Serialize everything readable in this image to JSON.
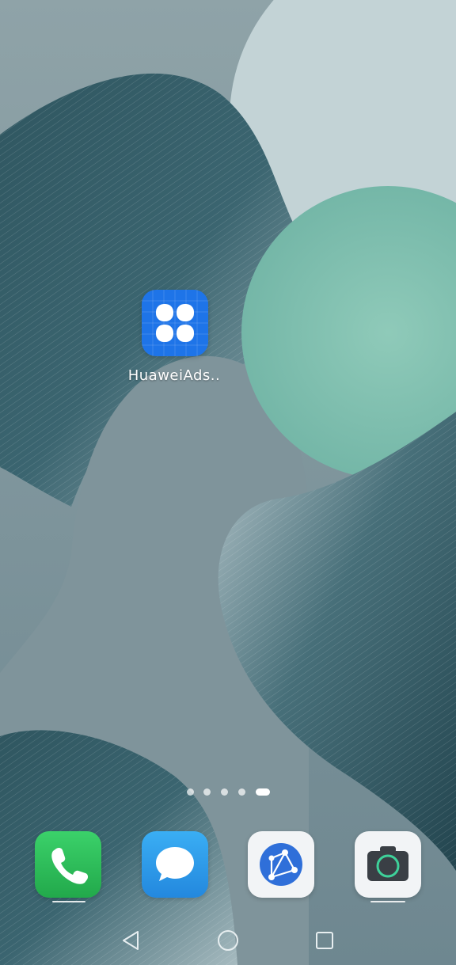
{
  "home": {
    "apps": [
      {
        "label": "HuaweiAds..",
        "icon": "huawei-ads-grid-icon"
      }
    ]
  },
  "pager": {
    "count": 5,
    "active_index": 4
  },
  "dock": [
    {
      "name": "phone",
      "icon": "phone-icon",
      "color": "#2dbd59"
    },
    {
      "name": "messages",
      "icon": "message-bubble-icon",
      "color": "#2fa0ec"
    },
    {
      "name": "browser",
      "icon": "globe-network-icon",
      "color": "#2f6fd9"
    },
    {
      "name": "camera",
      "icon": "camera-icon",
      "color": "#3a3f45"
    }
  ],
  "navbar": {
    "back": "back-triangle-icon",
    "home": "home-circle-icon",
    "recents": "recents-square-icon"
  },
  "colors": {
    "wallpaper_base": "#7a8f96",
    "ads_icon_bg": "#1e74e8"
  }
}
